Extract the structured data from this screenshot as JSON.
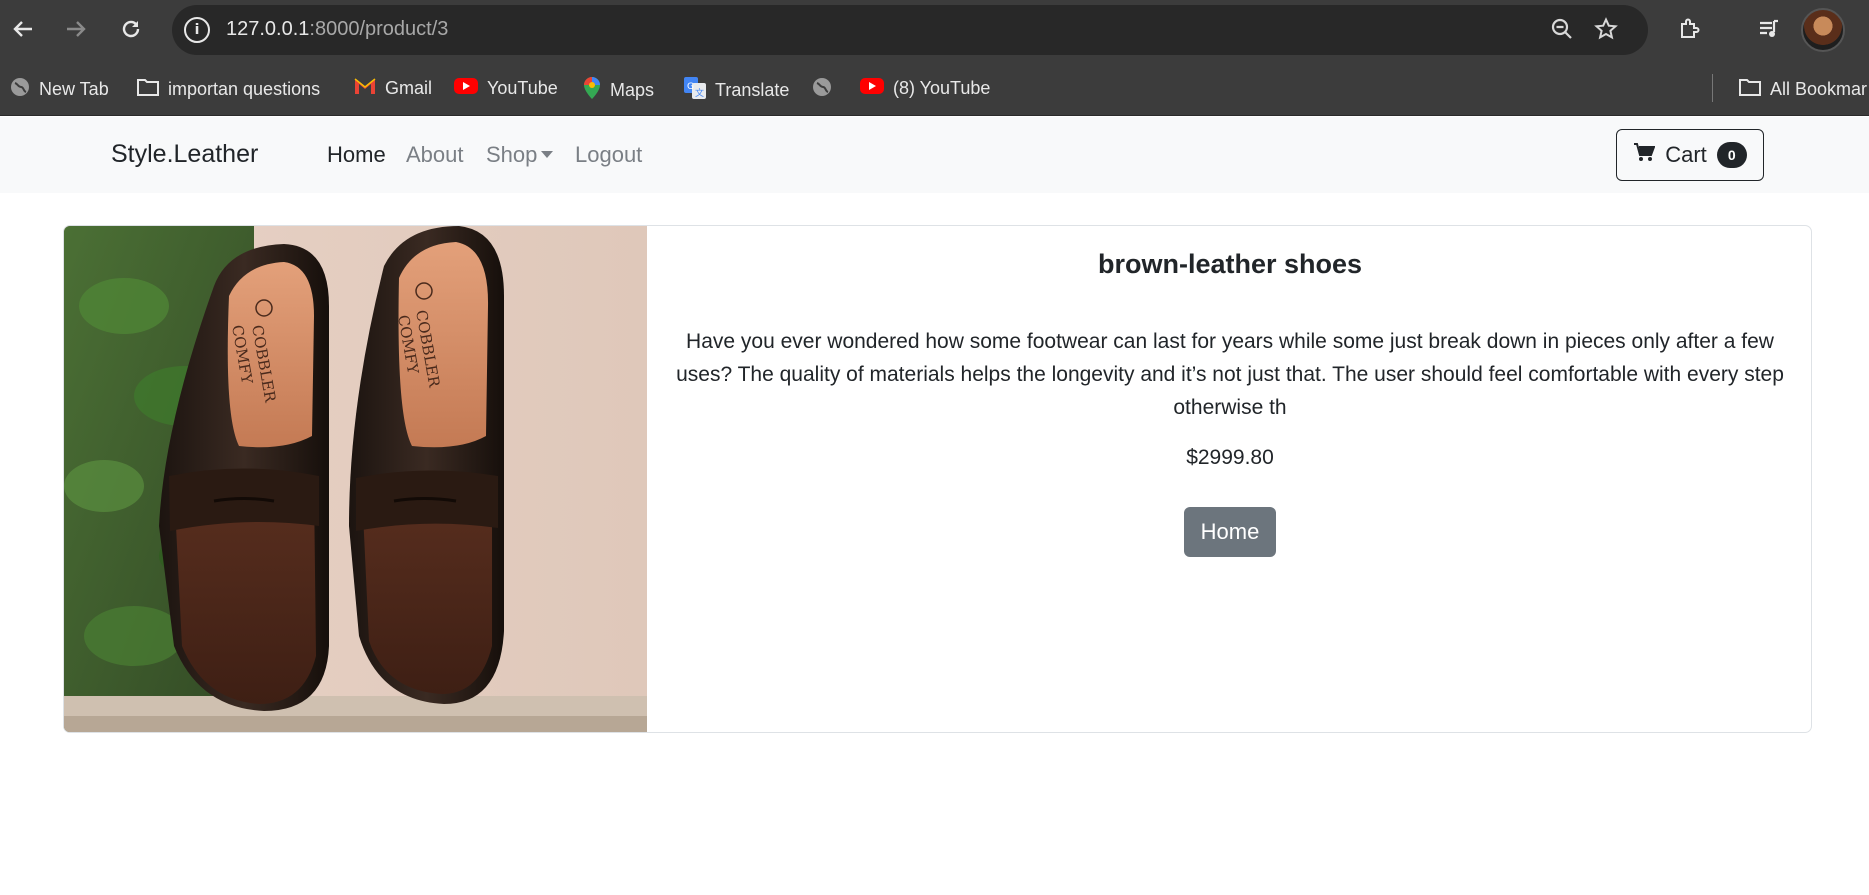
{
  "browser": {
    "url_host": "127.0.0.1",
    "url_rest": ":8000/product/3",
    "icons": [
      "back-arrow-icon",
      "forward-arrow-icon",
      "reload-icon",
      "info-icon",
      "zoom-icon",
      "star-icon",
      "extensions-icon",
      "media-icon",
      "profile-avatar"
    ],
    "bookmarks": [
      {
        "label": "New Tab",
        "icon": "globe-icon"
      },
      {
        "label": "importan questions",
        "icon": "folder-icon"
      },
      {
        "label": "Gmail",
        "icon": "gmail-icon"
      },
      {
        "label": "YouTube",
        "icon": "youtube-icon"
      },
      {
        "label": "Maps",
        "icon": "maps-icon"
      },
      {
        "label": "Translate",
        "icon": "translate-icon"
      },
      {
        "label": "",
        "icon": "globe-icon"
      },
      {
        "label": "(8) YouTube",
        "icon": "youtube-icon"
      }
    ],
    "all_bookmarks": "All Bookmar"
  },
  "navbar": {
    "brand": "Style.Leather",
    "links": [
      "Home",
      "About",
      "Shop",
      "Logout"
    ],
    "cart_label": "Cart",
    "cart_count": "0"
  },
  "product": {
    "title": "brown-leather shoes",
    "description": "Have you ever wondered how some footwear can last for years while some just break down in pieces only after a few uses? The quality of materials helps the longevity and it’s not just that. The user should feel comfortable with every step otherwise th",
    "price": "$2999.80",
    "button_label": "Home",
    "image_brand": "COBBLER COMFY",
    "image_size": "7"
  },
  "colors": {
    "chrome": "#3c3c3c",
    "omnibox": "#282828",
    "navbar_bg": "#f8f9fa",
    "button_secondary": "#6c757d",
    "text_dark": "#212529"
  }
}
